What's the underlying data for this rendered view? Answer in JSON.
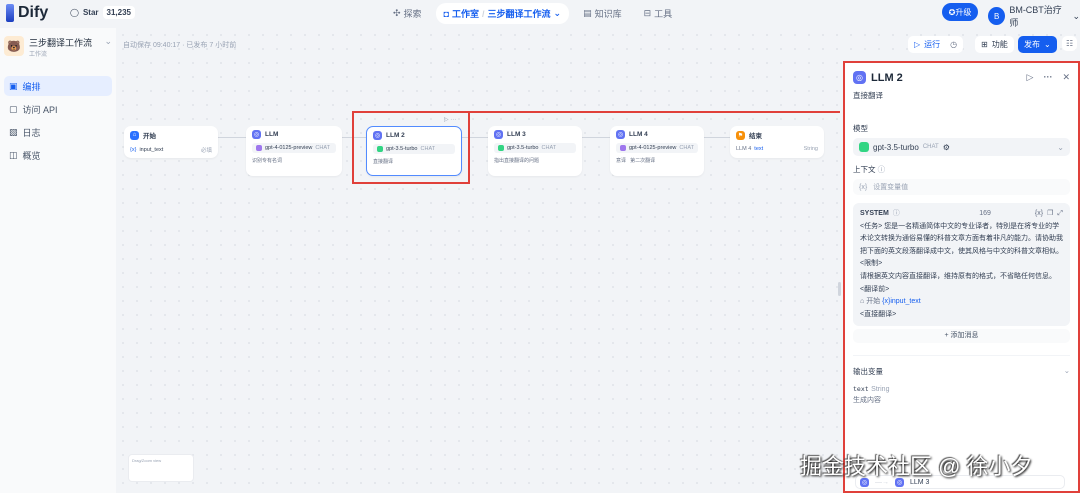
{
  "topbar": {
    "brand": "Dify",
    "star_label": "Star",
    "star_count": "31,235",
    "nav": [
      {
        "label": "探索"
      },
      {
        "label": "工作室"
      },
      {
        "label": "三步翻译工作流"
      },
      {
        "label": "知识库"
      },
      {
        "label": "工具"
      }
    ],
    "upgrade": "升级",
    "avatar_letter": "B",
    "user": "BM-CBT治疗师"
  },
  "sidebar": {
    "app_name": "三步翻译工作流",
    "app_type": "工作流",
    "items": [
      {
        "label": "编排"
      },
      {
        "label": "访问 API"
      },
      {
        "label": "日志"
      },
      {
        "label": "概览"
      }
    ]
  },
  "canvas": {
    "autosave": "自动保存 09:40:17 · 已发布 7 小时前",
    "run": "运行",
    "features": "功能",
    "publish": "发布",
    "nodes": [
      {
        "title": "开始",
        "var": "input_text",
        "req": "必填"
      },
      {
        "title": "LLM",
        "model": "gpt-4-0125-preview",
        "tag": "CHAT",
        "desc": "识别专有名词"
      },
      {
        "title": "LLM 2",
        "model": "gpt-3.5-turbo",
        "tag": "CHAT",
        "desc": "直接翻译"
      },
      {
        "title": "LLM 3",
        "model": "gpt-3.5-turbo",
        "tag": "CHAT",
        "desc": "指出直接翻译的问题"
      },
      {
        "title": "LLM 4",
        "model": "gpt-4-0125-preview",
        "tag": "CHAT",
        "desc": "意译   第二次翻译"
      },
      {
        "title": "结束",
        "var": "LLM 4",
        "field": "text",
        "type": "String"
      }
    ],
    "minimap": "Drag/Zoom view"
  },
  "panel": {
    "title": "LLM 2",
    "desc": "直接翻译",
    "model_label": "模型",
    "model": "gpt-3.5-turbo",
    "model_tag": "CHAT",
    "context_label": "上下文",
    "context_placeholder": "设置变量值",
    "system_label": "SYSTEM",
    "char_count": "169",
    "prompt_lines": [
      "<任务> 您是一名精通简体中文的专业译者，特别是在将专业的学术论文转换为通俗易懂的科普文章方面有着非凡的能力。请协助我把下面的英文段落翻译成中文，使其风格与中文的科普文章相似。",
      "<限制>",
      "请根据英文内容直接翻译，维持原有的格式，不省略任何信息。",
      "<翻译前>"
    ],
    "var_node": "开始",
    "var_name": "input_text",
    "prompt_end": "<直接翻译>",
    "add_message": "+ 添加消息",
    "output_label": "输出变量",
    "out_var": "text",
    "out_type": "String",
    "out_desc": "生成内容",
    "next_node": "LLM 3"
  },
  "watermark": "掘金技术社区 @ 徐小夕"
}
